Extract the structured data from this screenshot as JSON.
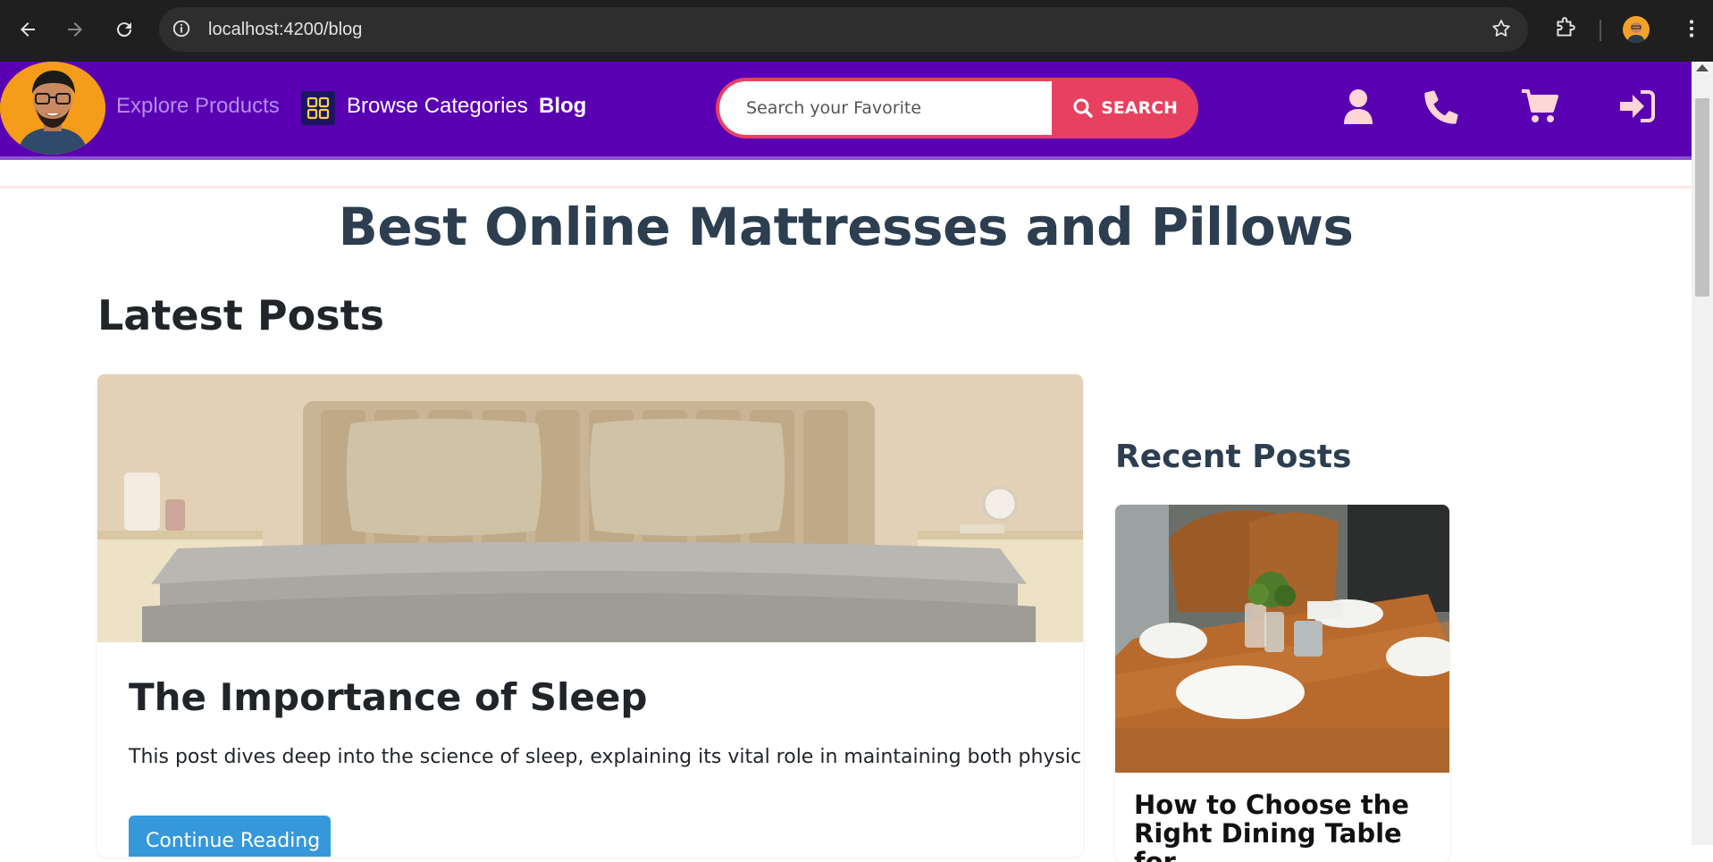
{
  "browser": {
    "url_host": "localhost",
    "url_rest": ":4200/blog"
  },
  "nav": {
    "explore_label": "Explore Products",
    "categories_label": "Browse Categories",
    "blog_label": "Blog",
    "search_placeholder": "Search your Favorite",
    "search_button_label": "SEARCH"
  },
  "page": {
    "title": "Best Online Mattresses and Pillows",
    "latest_heading": "Latest Posts",
    "recent_heading": "Recent Posts"
  },
  "featured_post": {
    "title": "The Importance of Sleep",
    "excerpt": "This post dives deep into the science of sleep, explaining its vital role in maintaining both physic...",
    "button_label": "Continue Reading"
  },
  "recent_posts": [
    {
      "title": "How to Choose the Right Dining Table for"
    }
  ],
  "colors": {
    "navbar": "#5a00b3",
    "search_button": "#e8405f",
    "title_text": "#2c3e50",
    "primary_button": "#3498db"
  }
}
